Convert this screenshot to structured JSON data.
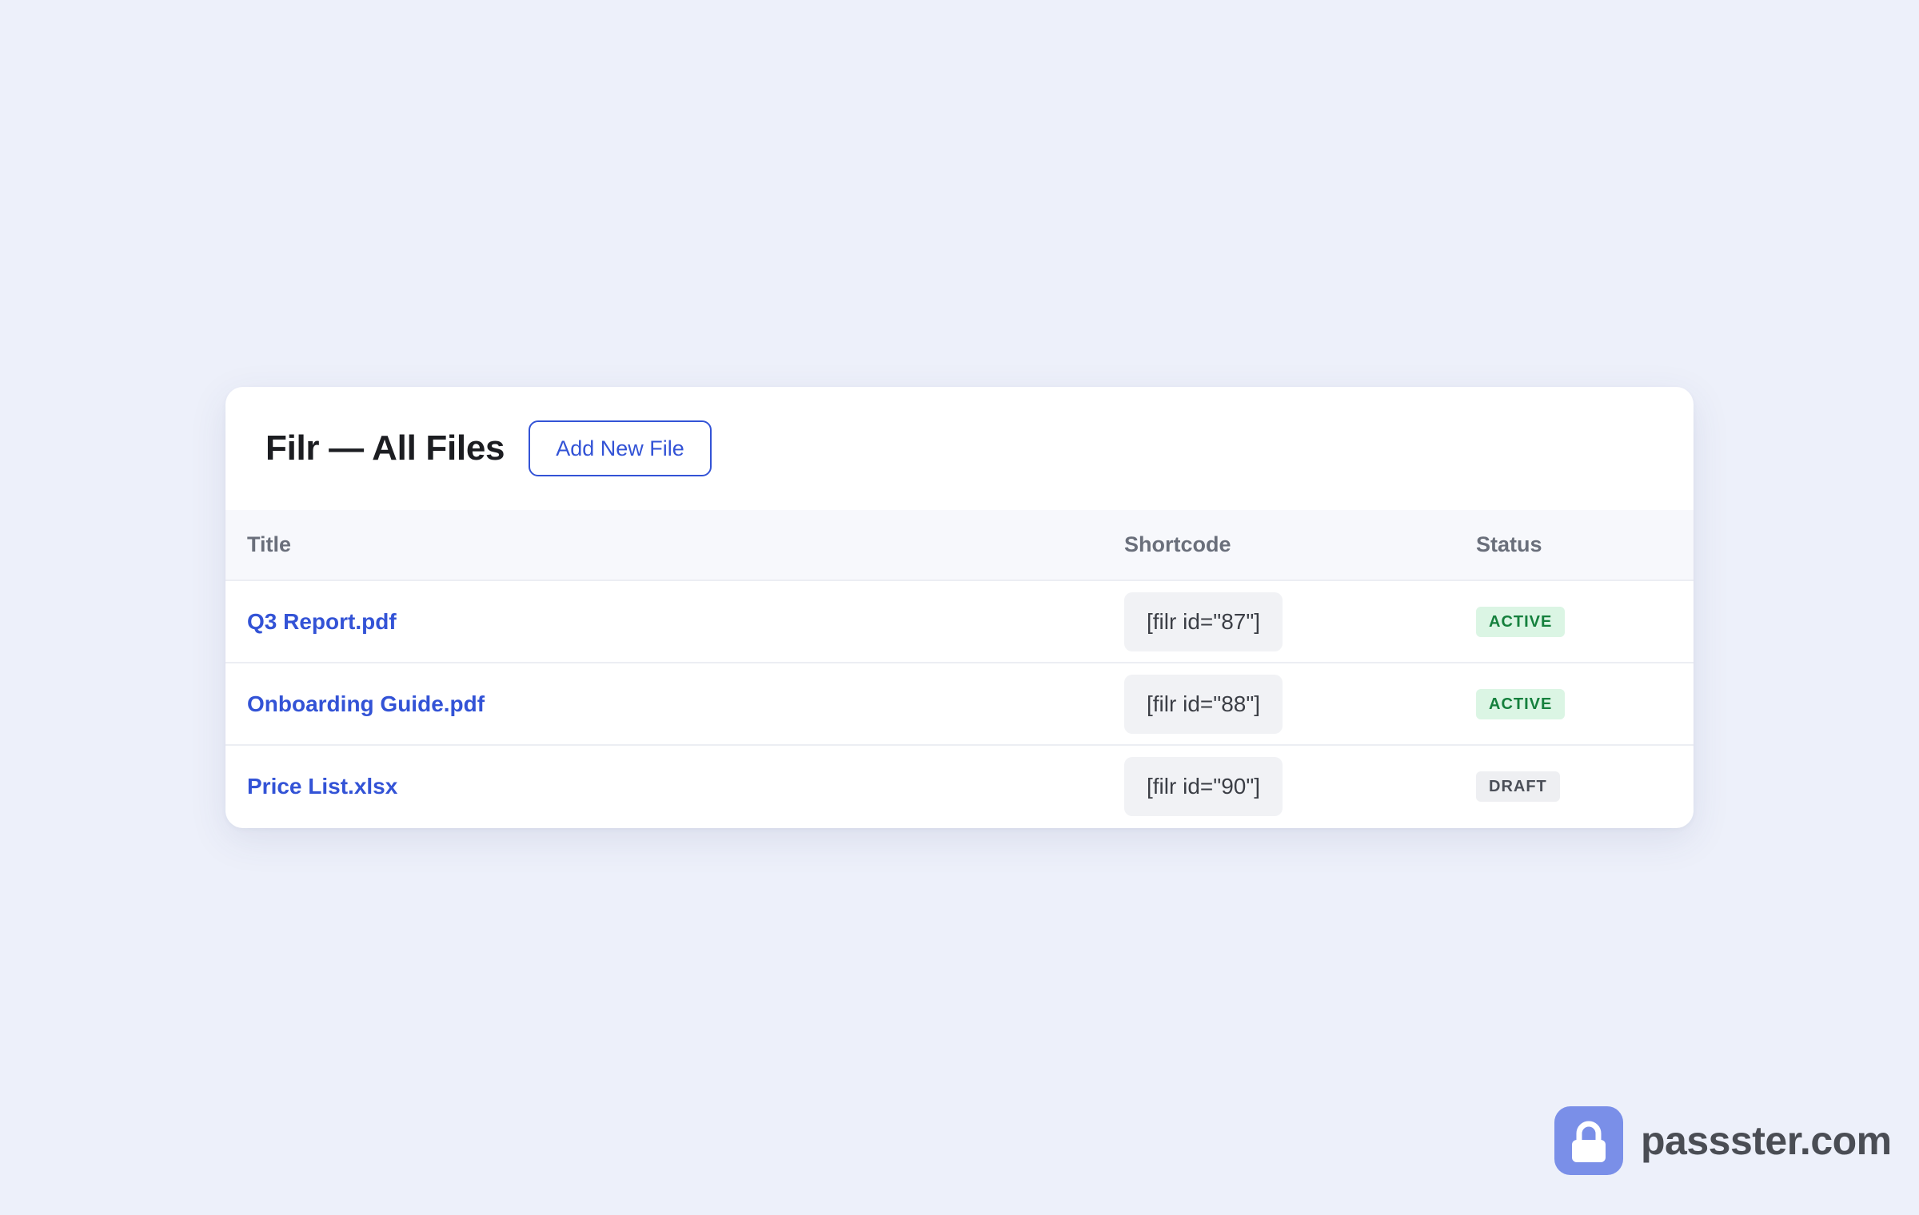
{
  "header": {
    "title": "Filr — All Files",
    "add_button_label": "Add New File"
  },
  "table": {
    "columns": [
      "Title",
      "Shortcode",
      "Status"
    ],
    "rows": [
      {
        "title": "Q3 Report.pdf",
        "shortcode": "[filr id=\"87\"]",
        "status": "ACTIVE"
      },
      {
        "title": "Onboarding Guide.pdf",
        "shortcode": "[filr id=\"88\"]",
        "status": "ACTIVE"
      },
      {
        "title": "Price List.xlsx",
        "shortcode": "[filr id=\"90\"]",
        "status": "DRAFT"
      }
    ]
  },
  "brand": {
    "icon": "lock-icon",
    "text": "passster.com",
    "color": "#7a8fe8"
  },
  "colors": {
    "accent": "#3353d6",
    "active_badge_bg": "#dbf5e4",
    "active_badge_text": "#15803d",
    "draft_badge_bg": "#eeeff2",
    "draft_badge_text": "#4b4f58",
    "page_background": "#edf0fa"
  }
}
